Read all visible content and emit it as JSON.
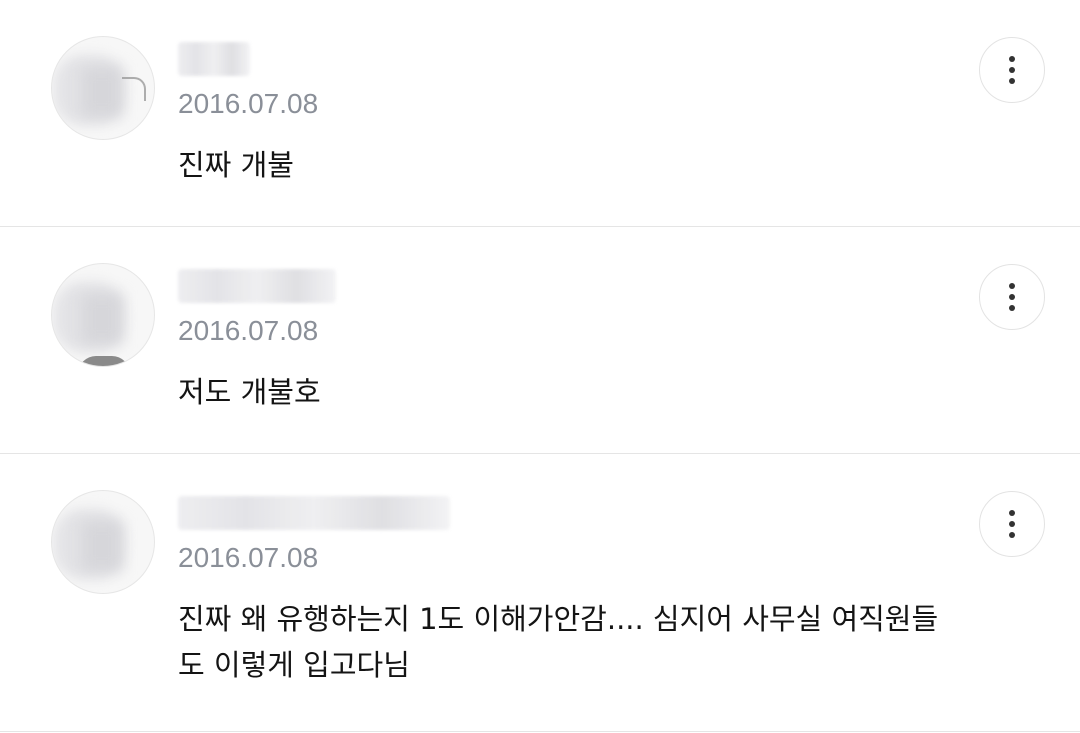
{
  "comments": [
    {
      "author": "",
      "date": "2016.07.08",
      "text": "진짜 개불",
      "more_icon": "more-vertical-icon"
    },
    {
      "author": "",
      "date": "2016.07.08",
      "text": "저도 개불호",
      "more_icon": "more-vertical-icon"
    },
    {
      "author": "",
      "date": "2016.07.08",
      "text": "진짜 왜 유행하는지 1도 이해가안감.... 심지어 사무실 여직원들도 이렇게 입고다님",
      "more_icon": "more-vertical-icon"
    }
  ]
}
